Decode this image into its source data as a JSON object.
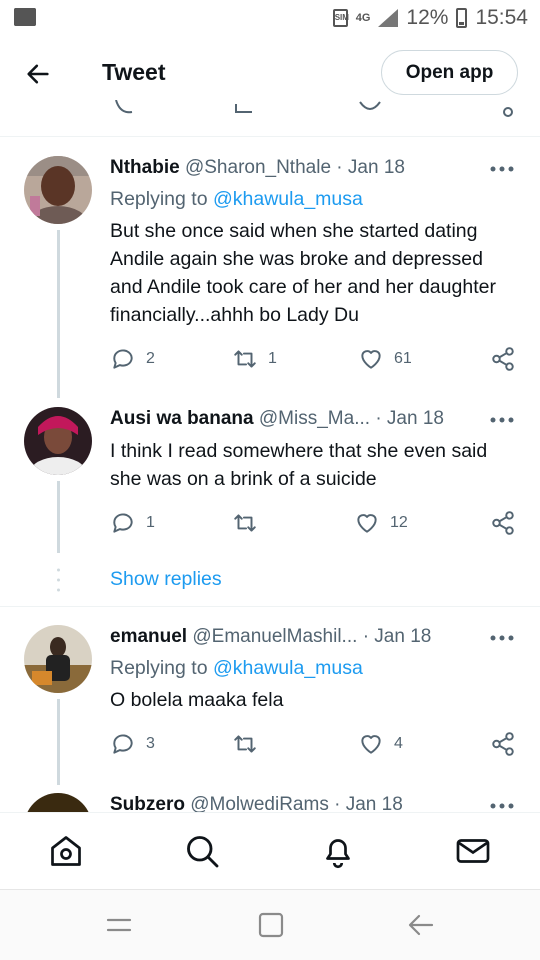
{
  "status_bar": {
    "network": "4G",
    "battery": "12%",
    "time": "15:54",
    "icons": [
      "gallery-icon",
      "activity-icon",
      "sim-icon",
      "signal-icon",
      "battery-icon"
    ]
  },
  "header": {
    "title": "Tweet",
    "open_app_label": "Open app"
  },
  "colors": {
    "link": "#1d9bf0",
    "secondary_text": "#536471",
    "primary_text": "#0f1419"
  },
  "tweets": [
    {
      "name": "Nthabie",
      "handle": "@Sharon_Nthale",
      "date": "· Jan 18",
      "replying_prefix": "Replying to",
      "replying_to": "@khawula_musa",
      "text": "But she once said when she started dating Andile again she was broke and depressed and Andile took care of her and her daughter financially...ahhh bo Lady Du",
      "replies": "2",
      "retweets": "1",
      "likes": "61"
    },
    {
      "name": "Ausi wa banana",
      "handle": "@Miss_Ma...",
      "date": "· Jan 18",
      "text": "I think I read somewhere that she even said she was on a brink of a suicide",
      "replies": "1",
      "retweets": "",
      "likes": "12",
      "show_replies": "Show replies"
    },
    {
      "name": "emanuel",
      "handle": "@EmanuelMashil...",
      "date": "· Jan 18",
      "replying_prefix": "Replying to",
      "replying_to": "@khawula_musa",
      "text": "O bolela maaka fela",
      "replies": "3",
      "retweets": "",
      "likes": "4"
    },
    {
      "name": "Subzero",
      "handle": "@MolwediRams",
      "date": "· Jan 18"
    }
  ],
  "bottom_nav": [
    "home-icon",
    "search-icon",
    "notifications-icon",
    "messages-icon"
  ],
  "system_nav": [
    "recents-icon",
    "home-square-icon",
    "back-arrow-icon"
  ]
}
